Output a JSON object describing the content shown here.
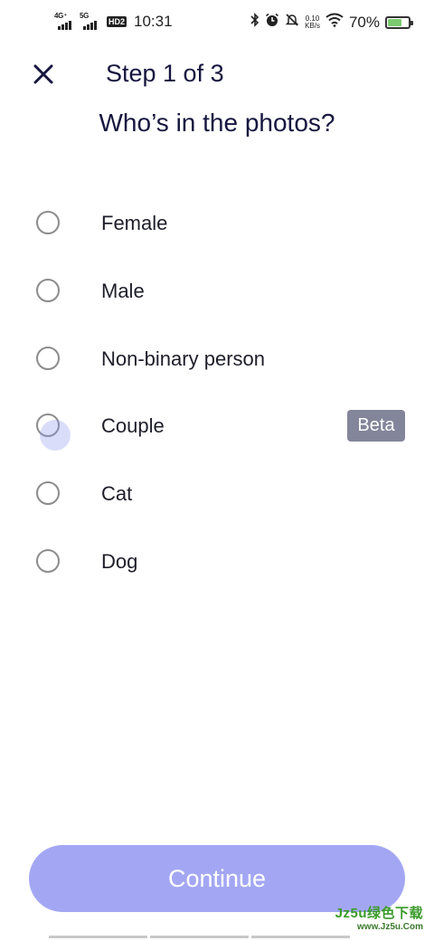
{
  "status_bar": {
    "sim1_network": "4G⁺",
    "sim2_network": "5G",
    "hd_label": "HD2",
    "time": "10:31",
    "net_speed_value": "0.10",
    "net_speed_unit": "KB/s",
    "battery_percent": "70%",
    "battery_level": 0.7,
    "icons": [
      "bluetooth-icon",
      "alarm-icon",
      "mute-icon",
      "wifi-icon",
      "battery-icon"
    ]
  },
  "header": {
    "close_icon": "close-icon",
    "step_title": "Step 1 of 3",
    "question": "Who’s in the photos?"
  },
  "options": [
    {
      "label": "Female",
      "badge": ""
    },
    {
      "label": "Male",
      "badge": ""
    },
    {
      "label": "Non-binary person",
      "badge": ""
    },
    {
      "label": "Couple",
      "badge": "Beta",
      "pressed": true
    },
    {
      "label": "Cat",
      "badge": ""
    },
    {
      "label": "Dog",
      "badge": ""
    }
  ],
  "continue_label": "Continue",
  "watermark": {
    "main": "Jz5u绿色下载",
    "sub": "www.Jz5u.Com"
  },
  "colors": {
    "title": "#16163f",
    "continue_bg": "#a3a7f3",
    "beta_bg": "#83869a",
    "radio_border": "#8c8c8c",
    "battery_fill": "#7bc96f"
  }
}
